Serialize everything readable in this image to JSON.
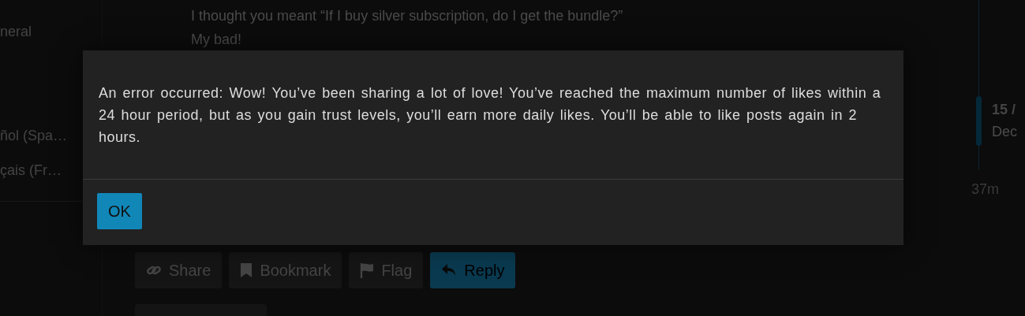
{
  "sidebar": {
    "items": [
      {
        "label": "neral"
      },
      {
        "label": "ñol (Spa…"
      },
      {
        "label": "çais (Fr…"
      }
    ]
  },
  "post": {
    "lines": [
      "I thought you meant “If I buy silver subscription, do I get the bundle?”",
      "My bad!"
    ],
    "actions": [
      {
        "label": "Share",
        "kind": "share"
      },
      {
        "label": "Bookmark",
        "kind": "bookmark"
      },
      {
        "label": "Flag",
        "kind": "flag"
      },
      {
        "label": "Reply",
        "kind": "reply"
      }
    ]
  },
  "timeline": {
    "position": "15 /",
    "date": "Dec",
    "last": "37m"
  },
  "dialog": {
    "message": "An error occurred: Wow! You’ve been sharing a lot of love! You’ve reached the maximum number of likes within a 24 hour period, but as you gain trust levels, you’ll earn more daily likes. You’ll be able to like posts again in 2 hours.",
    "buttons": [
      "OK"
    ]
  }
}
